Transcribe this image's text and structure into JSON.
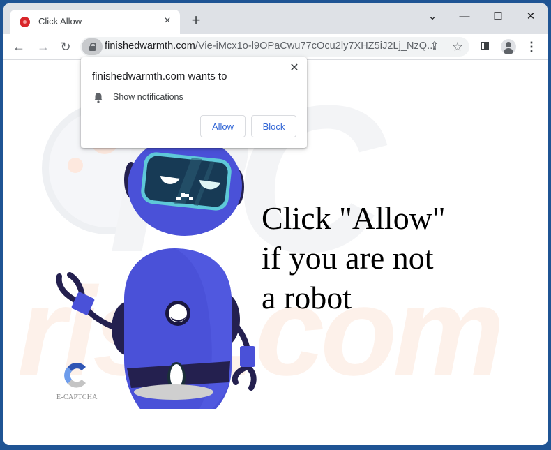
{
  "browser": {
    "tab": {
      "title": "Click Allow",
      "favicon": "red-circle-favicon",
      "close_label": "×"
    },
    "new_tab_label": "+",
    "window_controls": {
      "tab_search": "⌄",
      "minimize": "—",
      "maximize": "☐",
      "close": "✕"
    },
    "nav": {
      "back": "←",
      "forward": "→",
      "reload": "↻"
    },
    "address_bar": {
      "host": "finishedwarmth.com",
      "path": "/Vie-iMcx1o-l9OPaCwu77cOcu2ly7XHZ5iJ2Lj_NzQ..."
    },
    "toolbar_icons": {
      "share": "⇪",
      "bookmark": "☆",
      "menu": "⋮"
    }
  },
  "permission_popup": {
    "title": "finishedwarmth.com wants to",
    "permission": "Show notifications",
    "allow_label": "Allow",
    "block_label": "Block",
    "close_label": "✕"
  },
  "page": {
    "headline_lines": [
      "Click \"Allow\"",
      "if you are not",
      "a robot"
    ],
    "captcha_label": "E-CAPTCHA",
    "watermark_top": "PC",
    "watermark_bottom": "risk.com"
  },
  "colors": {
    "desktop_bg": "#1f5494",
    "robot_body": "#4a51d8",
    "robot_dark": "#24204f",
    "visor": "#173a55",
    "visor_rim": "#5ec8d8",
    "button_text": "#3367d6"
  }
}
